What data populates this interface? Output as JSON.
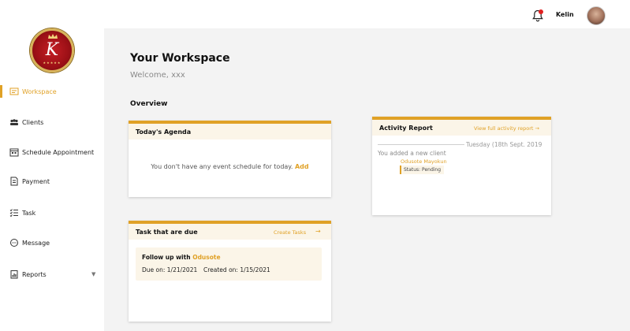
{
  "header": {
    "username": "Kelin",
    "notification_icon": "bell-icon",
    "avatar_icon": "user-avatar"
  },
  "sidebar": {
    "logo_letter": "K",
    "logo_stars": "★★★★★",
    "items": [
      {
        "label": "Workspace",
        "icon": "workspace-icon",
        "active": true
      },
      {
        "label": "Clients",
        "icon": "clients-icon",
        "active": false
      },
      {
        "label": "Schedule Appointment",
        "icon": "calendar-icon",
        "active": false
      },
      {
        "label": "Payment",
        "icon": "payment-icon",
        "active": false
      },
      {
        "label": "Task",
        "icon": "task-list-icon",
        "active": false
      },
      {
        "label": "Message",
        "icon": "message-icon",
        "active": false
      },
      {
        "label": "Reports",
        "icon": "reports-icon",
        "active": false,
        "has_dropdown": true
      }
    ]
  },
  "main": {
    "title": "Your Workspace",
    "welcome": "Welcome, xxx",
    "overview_label": "Overview",
    "agenda": {
      "title": "Today's Agenda",
      "empty_text": "You don't have any event schedule for today.",
      "add_link": "Add"
    },
    "tasks": {
      "title": "Task that are due",
      "create_link": "Create Tasks",
      "create_arrow": "→",
      "items": [
        {
          "prefix": "Follow up with",
          "name": "Odusote",
          "due": "Due on: 1/21/2021",
          "created": "Created on: 1/15/2021"
        }
      ]
    },
    "activity": {
      "title": "Activity Report",
      "view_link": "View full activity report →",
      "date": "Tuesday (18th Sept. 2019",
      "entry_text": "You added a new client",
      "entry_user": "Odusote Mayokun",
      "status": "Status: Pending"
    }
  },
  "colors": {
    "accent": "#e0a126",
    "header_tint": "#fbf5e8",
    "main_bg": "#f3f3f3"
  }
}
